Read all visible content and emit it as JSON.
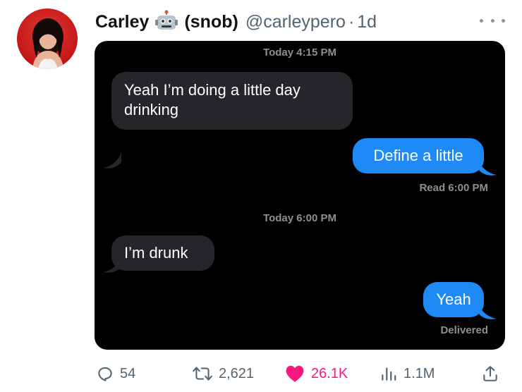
{
  "tweet": {
    "display_name": "Carley",
    "name_suffix": "(snob)",
    "name_emoji": "robot-face-icon",
    "handle": "@carleypero",
    "separator": "·",
    "age": "1d",
    "more_icon": "more-dots-icon"
  },
  "conversation": {
    "timestamp_1": "Today 4:15 PM",
    "message_1": "Yeah I’m doing a little day drinking",
    "message_2": "Define a little",
    "status_1": "Read 6:00 PM",
    "timestamp_2": "Today 6:00 PM",
    "message_3": "I’m drunk",
    "message_4": "Yeah",
    "status_2": "Delivered"
  },
  "actions": {
    "replies": "54",
    "reposts": "2,621",
    "likes": "26.1K",
    "views": "1.1M",
    "reply_icon": "reply-icon",
    "repost_icon": "repost-icon",
    "like_icon": "heart-icon",
    "views_icon": "analytics-icon",
    "share_icon": "share-icon"
  },
  "colors": {
    "sent_bubble": "#1f8af6",
    "received_bubble": "#26252a",
    "like_active": "#f91880",
    "muted_text": "#536471"
  }
}
